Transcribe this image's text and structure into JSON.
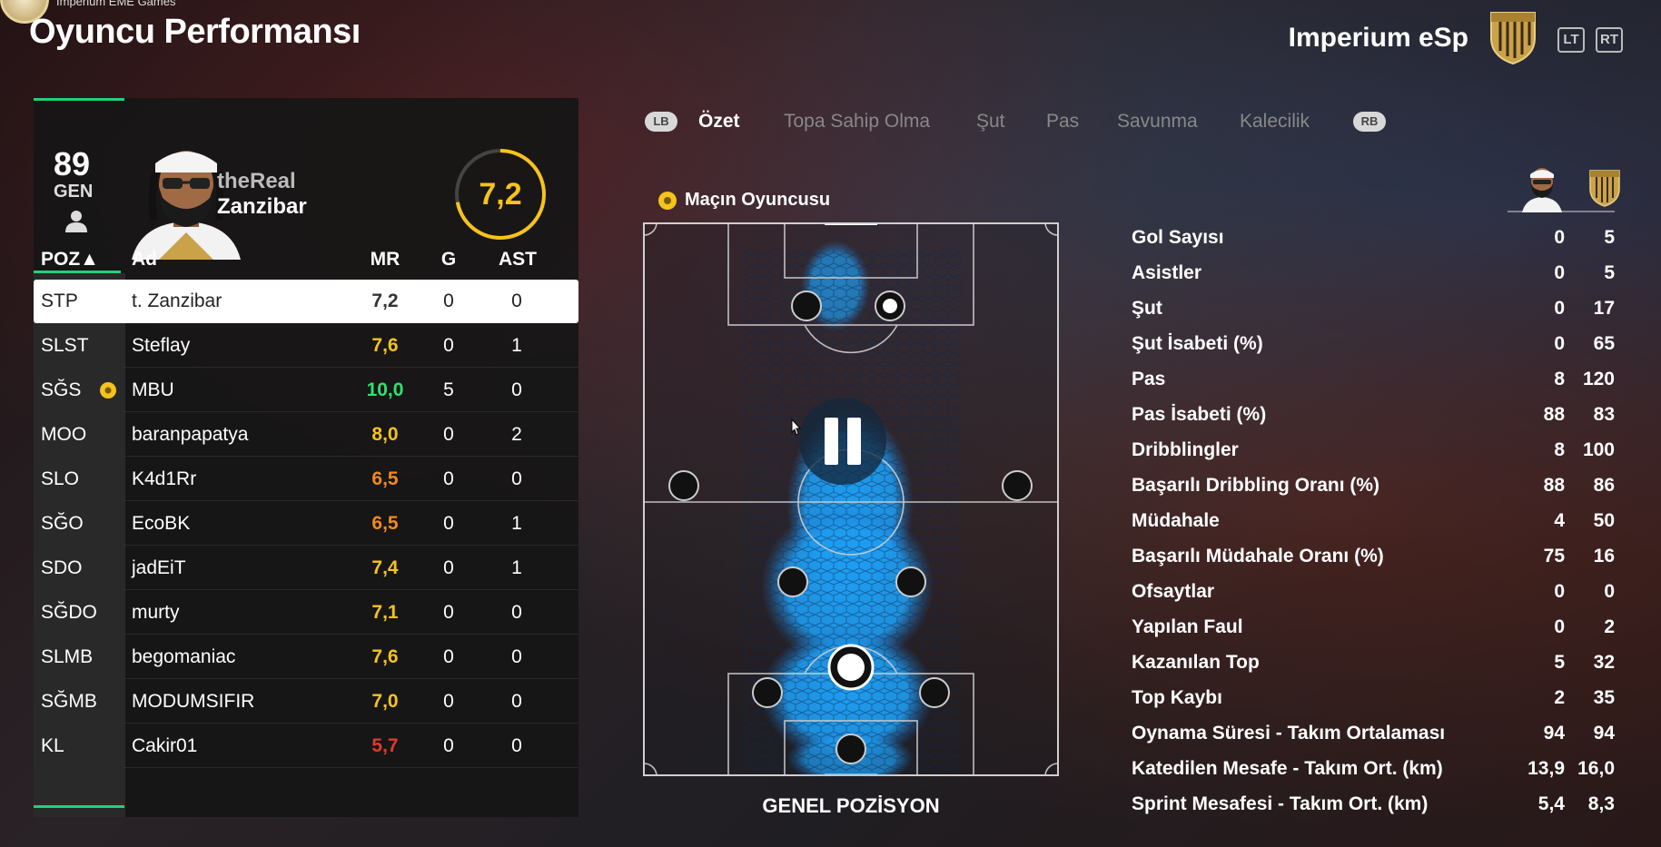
{
  "header": {
    "top_subtitle": "Imperium EME Games",
    "title": "Oyuncu Performansı",
    "team_name": "Imperium eSp",
    "lt_label": "LT",
    "rt_label": "RT"
  },
  "player": {
    "overall": "89",
    "overall_label": "GEN",
    "name_line1": "theReal",
    "name_line2": "Zanzibar",
    "match_rating": "7,2"
  },
  "table": {
    "headers": {
      "poz": "POZ▲",
      "ad": "Ad",
      "mr": "MR",
      "g": "G",
      "ast": "AST"
    },
    "rows": [
      {
        "poz": "STP",
        "ad": "t. Zanzibar",
        "mr": "7,2",
        "g": "0",
        "ast": "0",
        "mr_color": "#333333"
      },
      {
        "poz": "SLST",
        "ad": "Steflay",
        "mr": "7,6",
        "g": "0",
        "ast": "1",
        "mr_color": "#f5c31d"
      },
      {
        "poz": "SĞS",
        "ad": "MBU",
        "mr": "10,0",
        "g": "5",
        "ast": "0",
        "mr_color": "#2ee36e"
      },
      {
        "poz": "MOO",
        "ad": "baranpapatya",
        "mr": "8,0",
        "g": "0",
        "ast": "2",
        "mr_color": "#f5c31d"
      },
      {
        "poz": "SLO",
        "ad": "K4d1Rr",
        "mr": "6,5",
        "g": "0",
        "ast": "0",
        "mr_color": "#f08a1c"
      },
      {
        "poz": "SĞO",
        "ad": "EcoBK",
        "mr": "6,5",
        "g": "0",
        "ast": "1",
        "mr_color": "#f08a1c"
      },
      {
        "poz": "SDO",
        "ad": "jadEiT",
        "mr": "7,4",
        "g": "0",
        "ast": "1",
        "mr_color": "#f5c31d"
      },
      {
        "poz": "SĞDO",
        "ad": "murty",
        "mr": "7,1",
        "g": "0",
        "ast": "0",
        "mr_color": "#f5c31d"
      },
      {
        "poz": "SLMB",
        "ad": "begomaniac",
        "mr": "7,6",
        "g": "0",
        "ast": "0",
        "mr_color": "#f5c31d"
      },
      {
        "poz": "SĞMB",
        "ad": "MODUMSIFIR",
        "mr": "7,0",
        "g": "0",
        "ast": "0",
        "mr_color": "#f5c31d"
      },
      {
        "poz": "KL",
        "ad": "Cakir01",
        "mr": "5,7",
        "g": "0",
        "ast": "0",
        "mr_color": "#e03a2a"
      }
    ]
  },
  "tabs": {
    "lb": "LB",
    "rb": "RB",
    "items": [
      "Özet",
      "Topa Sahip Olma",
      "Şut",
      "Pas",
      "Savunma",
      "Kalecilik"
    ]
  },
  "pitch": {
    "motm_label": "Maçın Oyuncusu",
    "caption": "GENEL POZİSYON"
  },
  "stats": [
    {
      "label": "Gol Sayısı",
      "player": "0",
      "team": "5"
    },
    {
      "label": "Asistler",
      "player": "0",
      "team": "5"
    },
    {
      "label": "Şut",
      "player": "0",
      "team": "17"
    },
    {
      "label": "Şut İsabeti (%)",
      "player": "0",
      "team": "65"
    },
    {
      "label": "Pas",
      "player": "8",
      "team": "120"
    },
    {
      "label": "Pas İsabeti (%)",
      "player": "88",
      "team": "83"
    },
    {
      "label": "Dribblingler",
      "player": "8",
      "team": "100"
    },
    {
      "label": "Başarılı Dribbling Oranı (%)",
      "player": "88",
      "team": "86"
    },
    {
      "label": "Müdahale",
      "player": "4",
      "team": "50"
    },
    {
      "label": "Başarılı Müdahale Oranı (%)",
      "player": "75",
      "team": "16"
    },
    {
      "label": "Ofsaytlar",
      "player": "0",
      "team": "0"
    },
    {
      "label": "Yapılan Faul",
      "player": "0",
      "team": "2"
    },
    {
      "label": "Kazanılan Top",
      "player": "5",
      "team": "32"
    },
    {
      "label": "Top Kaybı",
      "player": "2",
      "team": "35"
    },
    {
      "label": "Oynama Süresi - Takım Ortalaması",
      "player": "94",
      "team": "94"
    },
    {
      "label": "Katedilen Mesafe - Takım Ort. (km)",
      "player": "13,9",
      "team": "16,0"
    },
    {
      "label": "Sprint Mesafesi - Takım Ort. (km)",
      "player": "5,4",
      "team": "8,3"
    }
  ],
  "colors": {
    "accent_green": "#21d07a",
    "rating_yellow": "#f5c31d",
    "heatmap_blue": "#1e9cf0"
  }
}
